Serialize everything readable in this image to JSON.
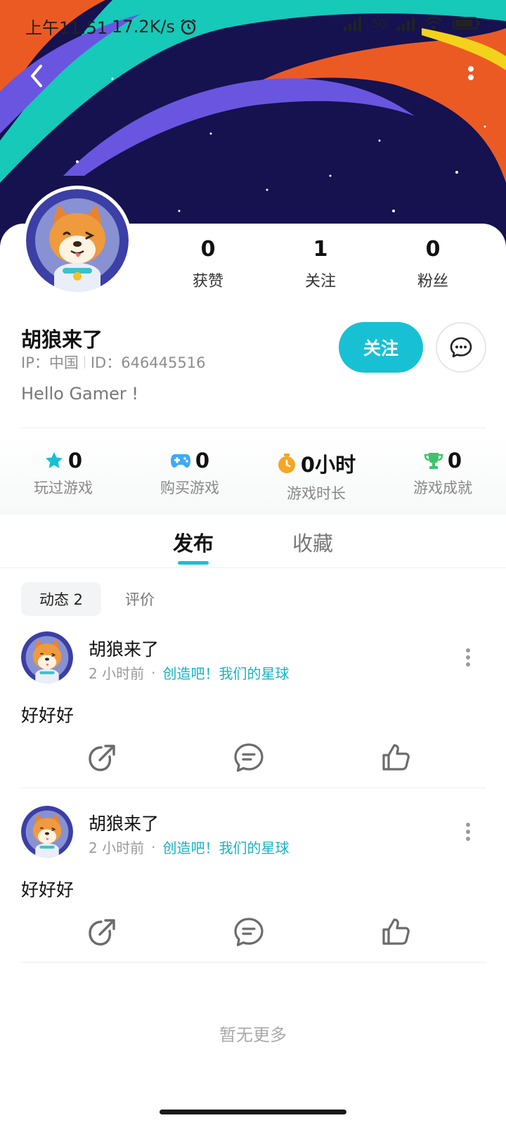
{
  "status_bar": {
    "time": "上午11:51",
    "net_speed": "17.2K/s",
    "signal": "5G"
  },
  "nav": {
    "back_icon": "chevron-left-icon",
    "more_icon": "more-vertical-icon"
  },
  "profile": {
    "avatar_icon": "shiba-astronaut-avatar",
    "name": "胡狼来了",
    "ip_label": "IP：中国",
    "id_label": "ID：646445516",
    "bio": "Hello Gamer !",
    "stats": [
      {
        "value": "0",
        "label": "获赞"
      },
      {
        "value": "1",
        "label": "关注"
      },
      {
        "value": "0",
        "label": "粉丝"
      }
    ],
    "follow_label": "关注",
    "message_icon": "chat-bubble-icon"
  },
  "game_stats": [
    {
      "icon": "star-icon",
      "color": "#17c1d3",
      "value": "0",
      "label": "玩过游戏"
    },
    {
      "icon": "gamepad-icon",
      "color": "#3fa9f5",
      "value": "0",
      "label": "购买游戏"
    },
    {
      "icon": "stopwatch-icon",
      "color": "#f5a623",
      "value": "0小时",
      "label": "游戏时长"
    },
    {
      "icon": "trophy-icon",
      "color": "#3cc46a",
      "value": "0",
      "label": "游戏成就"
    }
  ],
  "tabs": {
    "publish": "发布",
    "favorites": "收藏"
  },
  "subtabs": {
    "dynamic": "动态 2",
    "review": "评价"
  },
  "posts": [
    {
      "author": "胡狼来了",
      "time": "2 小时前",
      "dot": "·",
      "game": "创造吧！我们的星球",
      "content": "好好好"
    },
    {
      "author": "胡狼来了",
      "time": "2 小时前",
      "dot": "·",
      "game": "创造吧！我们的星球",
      "content": "好好好"
    }
  ],
  "footer": {
    "no_more": "暂无更多"
  },
  "colors": {
    "accent": "#17c1d3",
    "banner_bg": "#15124f",
    "stripe_teal": "#16c9b9",
    "stripe_orange": "#ec5a24",
    "stripe_purple": "#6a55e0",
    "stripe_yellow": "#f3d21c"
  }
}
